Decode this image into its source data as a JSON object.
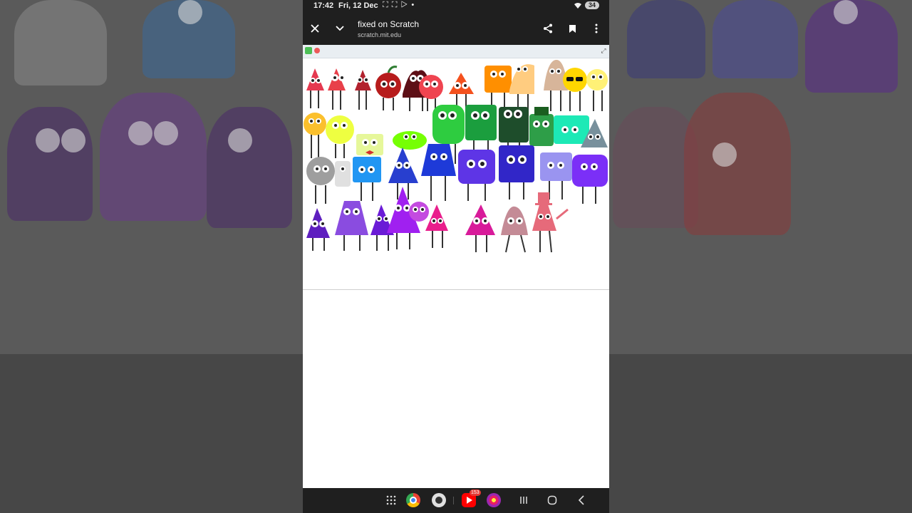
{
  "status_bar": {
    "time": "17:42",
    "date": "Fri, 12 Dec",
    "notif_icons": "⛶ ⛶ ▷ •",
    "battery": "34"
  },
  "toolbar": {
    "close_icon": "close-icon",
    "collapse_icon": "chevron-down-icon",
    "title": "fixed on Scratch",
    "url": "scratch.mit.edu",
    "share_icon": "share-icon",
    "bookmark_icon": "bookmark-icon",
    "menu_icon": "more-vert-icon"
  },
  "stage": {
    "green_flag": "green-flag-icon",
    "stop": "stop-icon",
    "fullscreen": "fullscreen-icon"
  },
  "navbar": {
    "apps_icon": "app-grid-icon",
    "chrome_icon": "chrome-icon",
    "camera_icon": "camera-icon",
    "youtube_icon": "youtube-icon",
    "youtube_badge": "153",
    "blossom_icon": "blossom-app-icon",
    "recents": "recents-icon",
    "home": "home-icon",
    "back": "back-icon"
  },
  "colors": {
    "system_bar": "#1f1f1f",
    "accent_red": "#e53935",
    "scratch_green": "#4cbf56",
    "scratch_red": "#ec5959"
  }
}
